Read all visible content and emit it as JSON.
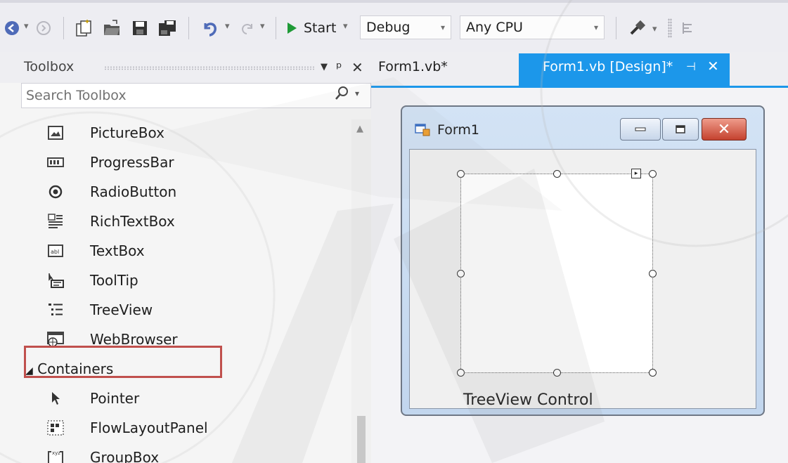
{
  "toolbar": {
    "start_label": "Start",
    "configuration": "Debug",
    "platform": "Any CPU"
  },
  "toolbox": {
    "title": "Toolbox",
    "search_placeholder": "Search Toolbox",
    "items": [
      {
        "label": "PictureBox",
        "icon": "picturebox-icon"
      },
      {
        "label": "ProgressBar",
        "icon": "progressbar-icon"
      },
      {
        "label": "RadioButton",
        "icon": "radiobutton-icon"
      },
      {
        "label": "RichTextBox",
        "icon": "richtextbox-icon"
      },
      {
        "label": "TextBox",
        "icon": "textbox-icon"
      },
      {
        "label": "ToolTip",
        "icon": "tooltip-icon"
      },
      {
        "label": "TreeView",
        "icon": "treeview-icon"
      },
      {
        "label": "WebBrowser",
        "icon": "webbrowser-icon"
      }
    ],
    "category": {
      "label": "Containers",
      "expanded": true
    },
    "category_items": [
      {
        "label": "Pointer",
        "icon": "pointer-icon"
      },
      {
        "label": "FlowLayoutPanel",
        "icon": "flowlayoutpanel-icon"
      },
      {
        "label": "GroupBox",
        "icon": "groupbox-icon"
      }
    ],
    "highlighted_item": "TreeView"
  },
  "tabs": [
    {
      "label": "Form1.vb*",
      "active": false
    },
    {
      "label": "Form1.vb [Design]*",
      "active": true
    }
  ],
  "designer": {
    "form_title": "Form1",
    "caption": "TreeView Control"
  },
  "colors": {
    "accent": "#1c97ea",
    "highlight_box": "#c0504d",
    "start_green": "#1f9a37"
  }
}
